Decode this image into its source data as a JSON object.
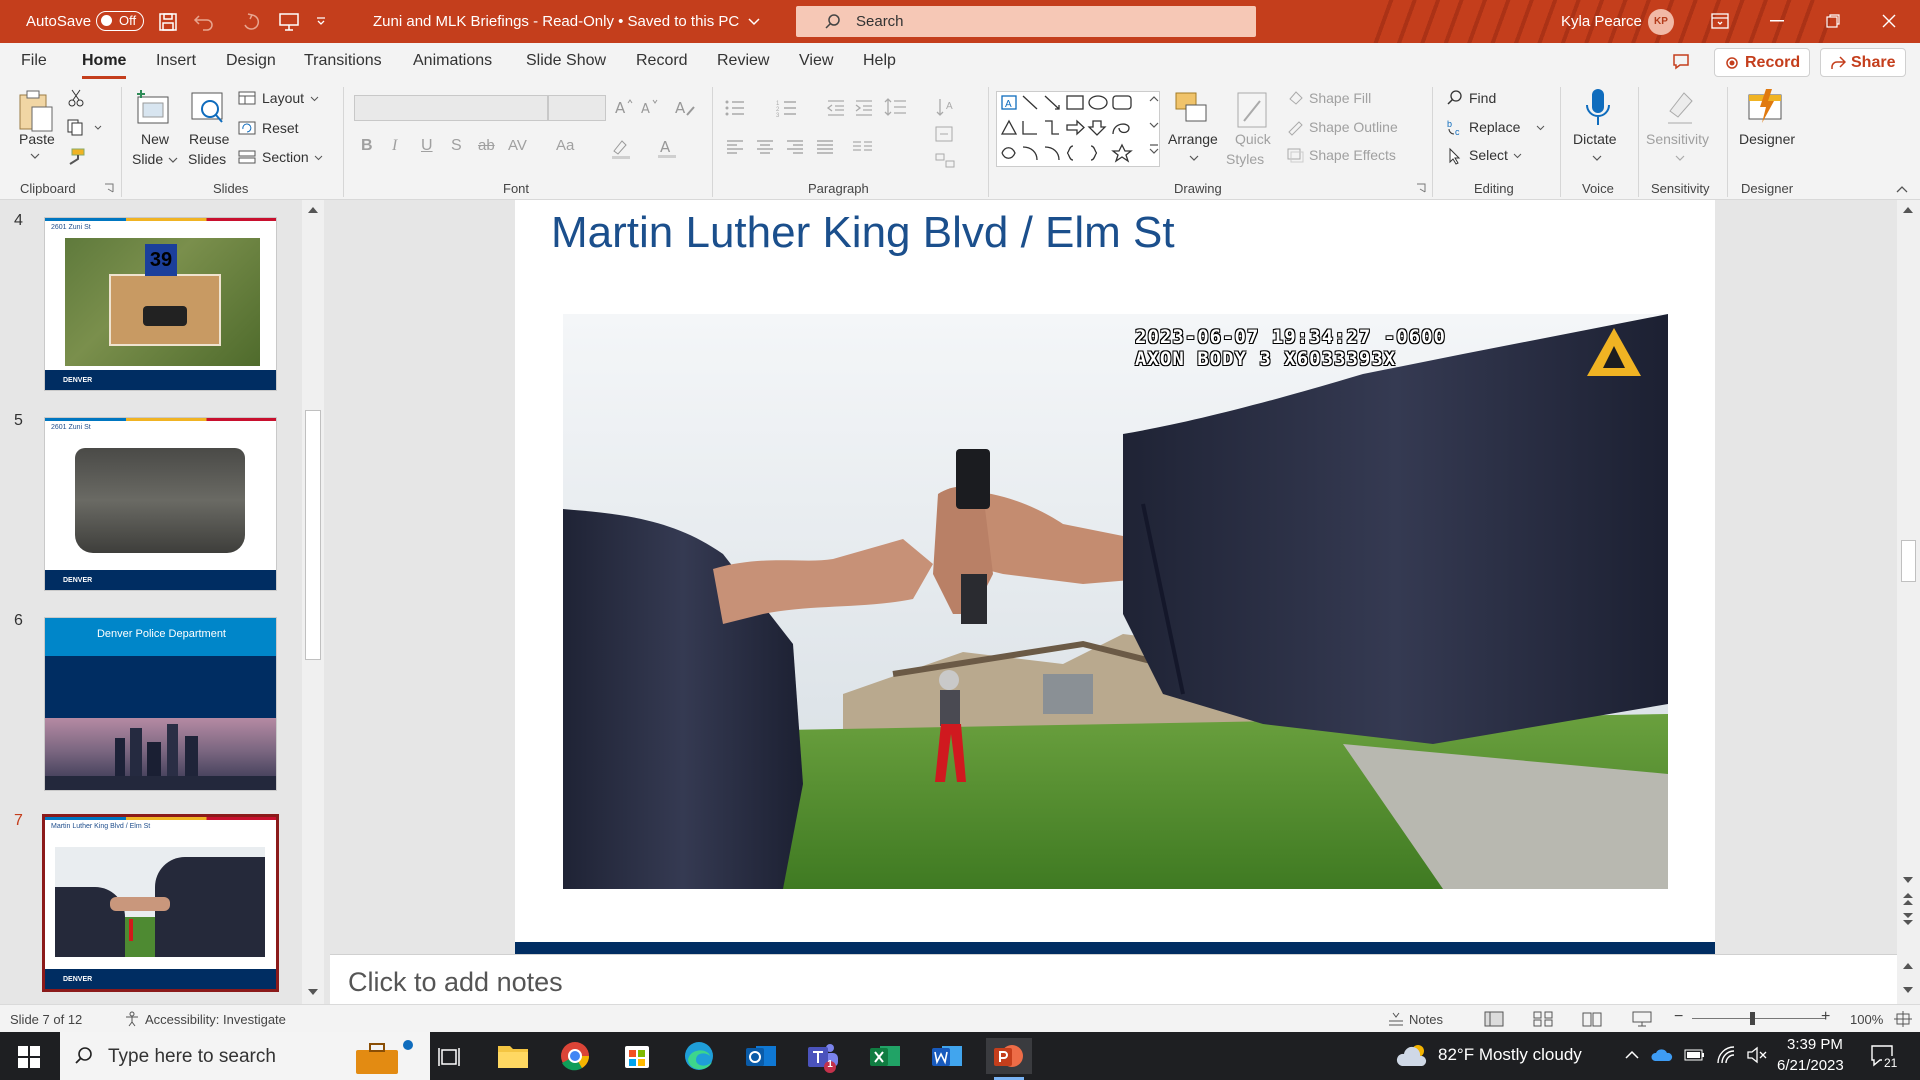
{
  "titlebar": {
    "autosave_label": "AutoSave",
    "autosave_state": "Off",
    "document_title": "Zuni and MLK Briefings  -  Read-Only  •  Saved to this PC",
    "search_placeholder": "Search",
    "user_name": "Kyla Pearce",
    "user_initials": "KP"
  },
  "tabs": [
    "File",
    "Home",
    "Insert",
    "Design",
    "Transitions",
    "Animations",
    "Slide Show",
    "Record",
    "Review",
    "View",
    "Help"
  ],
  "active_tab": "Home",
  "ribbon_actions": {
    "record": "Record",
    "share": "Share"
  },
  "ribbon": {
    "clipboard": {
      "label": "Clipboard",
      "paste": "Paste"
    },
    "slides": {
      "label": "Slides",
      "new_slide_1": "New",
      "new_slide_2": "Slide",
      "reuse_1": "Reuse",
      "reuse_2": "Slides",
      "layout": "Layout",
      "reset": "Reset",
      "section": "Section"
    },
    "font": {
      "label": "Font"
    },
    "paragraph": {
      "label": "Paragraph"
    },
    "drawing": {
      "label": "Drawing",
      "arrange": "Arrange",
      "quick_styles_1": "Quick",
      "quick_styles_2": "Styles",
      "shape_fill": "Shape Fill",
      "shape_outline": "Shape Outline",
      "shape_effects": "Shape Effects"
    },
    "editing": {
      "label": "Editing",
      "find": "Find",
      "replace": "Replace",
      "select": "Select"
    },
    "voice": {
      "label": "Voice",
      "dictate": "Dictate"
    },
    "sensitivity": {
      "label": "Sensitivity",
      "button": "Sensitivity"
    },
    "designer": {
      "label": "Designer",
      "button": "Designer"
    }
  },
  "thumbnails": [
    {
      "number": "4",
      "caption": "2601 Zuni St",
      "badge": "39",
      "footer": "DENVER"
    },
    {
      "number": "5",
      "caption": "2601 Zuni St",
      "footer": "DENVER"
    },
    {
      "number": "6",
      "caption": "Denver Police Department"
    },
    {
      "number": "7",
      "caption": "Martin Luther King Blvd / Elm St",
      "footer": "DENVER"
    }
  ],
  "selected_slide": "7",
  "slide": {
    "title": "Martin Luther King Blvd / Elm St",
    "timestamp_line1": "2023-06-07 19:34:27 -0600",
    "timestamp_line2": "AXON BODY 3 X6033393X"
  },
  "notes_placeholder": "Click to add notes",
  "status": {
    "slide_counter": "Slide 7 of 12",
    "accessibility": "Accessibility: Investigate",
    "notes": "Notes",
    "zoom": "100%"
  },
  "taskbar": {
    "search_placeholder": "Type here to search",
    "weather": "82°F  Mostly cloudy",
    "time": "3:39 PM",
    "date": "6/21/2023",
    "notification_count": "21",
    "teams_badge": "1"
  },
  "colors": {
    "accent": "#c43e1c",
    "slide_title": "#1b4f8c",
    "denver_navy": "#002d62",
    "selected_thumb": "#8b1a1a"
  }
}
